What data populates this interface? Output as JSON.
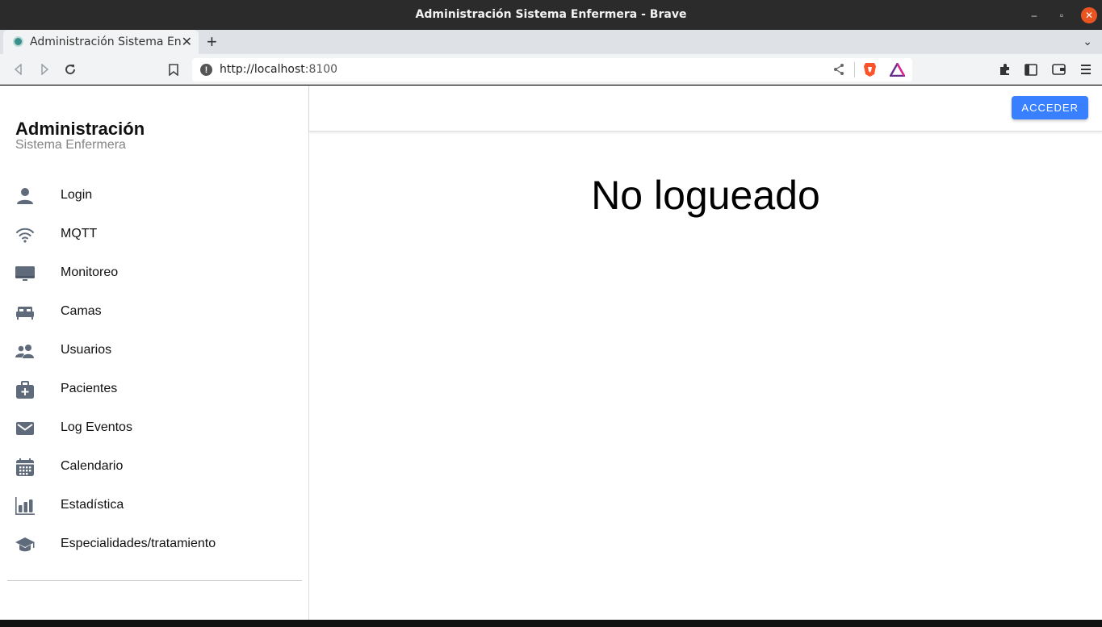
{
  "window": {
    "title": "Administración Sistema Enfermera - Brave",
    "minimize_glyph": "–",
    "maximize_glyph": "▫",
    "close_glyph": "✕"
  },
  "tabs": [
    {
      "label": "Administración Sistema Enfermera",
      "close": "✕"
    }
  ],
  "tabbar": {
    "new_tab": "+",
    "menu": "⌄"
  },
  "toolbar": {
    "url_scheme_host": "http://localhost",
    "url_port": ":8100",
    "info_glyph": "!"
  },
  "sidebar": {
    "title": "Administración",
    "subtitle": "Sistema Enfermera",
    "items": [
      {
        "label": "Login",
        "icon": "person-icon"
      },
      {
        "label": "MQTT",
        "icon": "wifi-icon"
      },
      {
        "label": "Monitoreo",
        "icon": "desktop-icon"
      },
      {
        "label": "Camas",
        "icon": "bed-icon"
      },
      {
        "label": "Usuarios",
        "icon": "people-icon"
      },
      {
        "label": "Pacientes",
        "icon": "medkit-icon"
      },
      {
        "label": "Log Eventos",
        "icon": "mail-icon"
      },
      {
        "label": "Calendario",
        "icon": "calendar-icon"
      },
      {
        "label": "Estadística",
        "icon": "stats-chart-icon"
      },
      {
        "label": "Especialidades/tratamiento",
        "icon": "school-icon"
      }
    ]
  },
  "header": {
    "login_button": "ACCEDER"
  },
  "main": {
    "heading": "No logueado"
  },
  "colors": {
    "accent": "#3880ff",
    "icon": "#5f6b7a",
    "close": "#e95420"
  }
}
